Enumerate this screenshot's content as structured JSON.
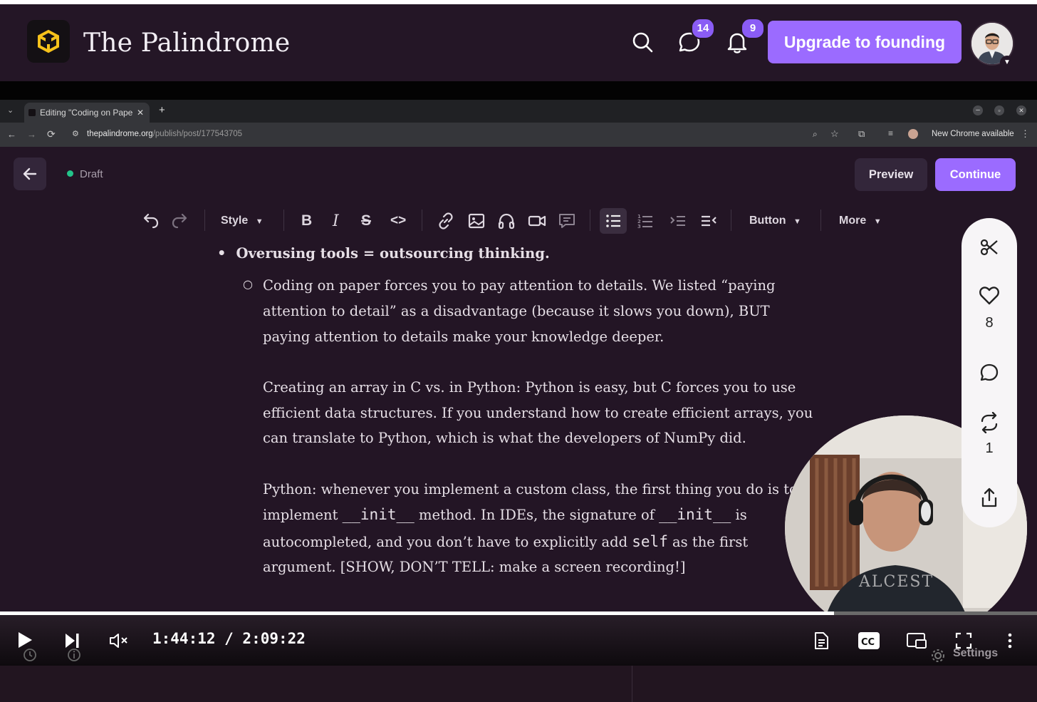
{
  "site": {
    "title": "The Palindrome"
  },
  "header": {
    "messages_badge": "14",
    "notifications_badge": "9",
    "upgrade_label": "Upgrade to founding"
  },
  "browser": {
    "tab_title": "Editing \"Coding on Pape",
    "url_host": "thepalindrome.org",
    "url_path": "/publish/post/177543705",
    "chrome_notice": "New Chrome available"
  },
  "editor": {
    "status": "Draft",
    "preview_label": "Preview",
    "continue_label": "Continue",
    "toolbar": {
      "style": "Style",
      "button": "Button",
      "more": "More"
    }
  },
  "document": {
    "bullet": "Overusing tools = outsourcing thinking.",
    "p1": [
      "Coding on paper forces you to pay attention to details. We listed “paying",
      "attention to detail” as a disadvantage (because it slows you down), BUT",
      "paying attention to details make your knowledge deeper."
    ],
    "p2": [
      "Creating an array in C vs. in Python: Python is easy, but C forces you to use",
      "efficient data structures. If you understand how to create efficient arrays, you",
      "can translate to Python, which is what the developers of NumPy did."
    ],
    "p3_line1": "Python: whenever you implement a custom class, the first thing you do is to",
    "p3_line2_a": "implement ",
    "p3_code1": "__init__",
    "p3_line2_b": " method. In IDEs, the signature of ",
    "p3_code2": "__init__",
    "p3_line2_c": " is",
    "p3_line3_a": "autocompleted, and you don’t have to explicitly add ",
    "p3_code3": "self",
    "p3_line3_b": " as the first",
    "p3_line4": "argument. [SHOW, DON’T TELL: make a screen recording!]"
  },
  "rail": {
    "likes": "8",
    "restacks": "1"
  },
  "player": {
    "time": "1:44:12 / 2:09:22",
    "progress": 0.804,
    "settings_label": "Settings"
  },
  "colors": {
    "accent": "#9b6bff",
    "background": "#231525",
    "badge": "#8a5cf5",
    "draft_dot": "#23c48a"
  },
  "icons": [
    "search-icon",
    "chat-icon",
    "bell-icon",
    "arrow-left-icon",
    "undo-icon",
    "redo-icon",
    "bold-icon",
    "italic-icon",
    "strikethrough-icon",
    "code-icon",
    "link-icon",
    "image-icon",
    "headphones-icon",
    "video-icon",
    "comment-icon",
    "bullet-list-icon",
    "numbered-list-icon",
    "indent-icon",
    "outdent-icon",
    "scissors-icon",
    "heart-icon",
    "restack-icon",
    "share-icon",
    "play-icon",
    "next-icon",
    "mute-icon",
    "transcript-icon",
    "cc-icon",
    "miniplayer-icon",
    "fullscreen-icon",
    "more-vertical-icon"
  ]
}
